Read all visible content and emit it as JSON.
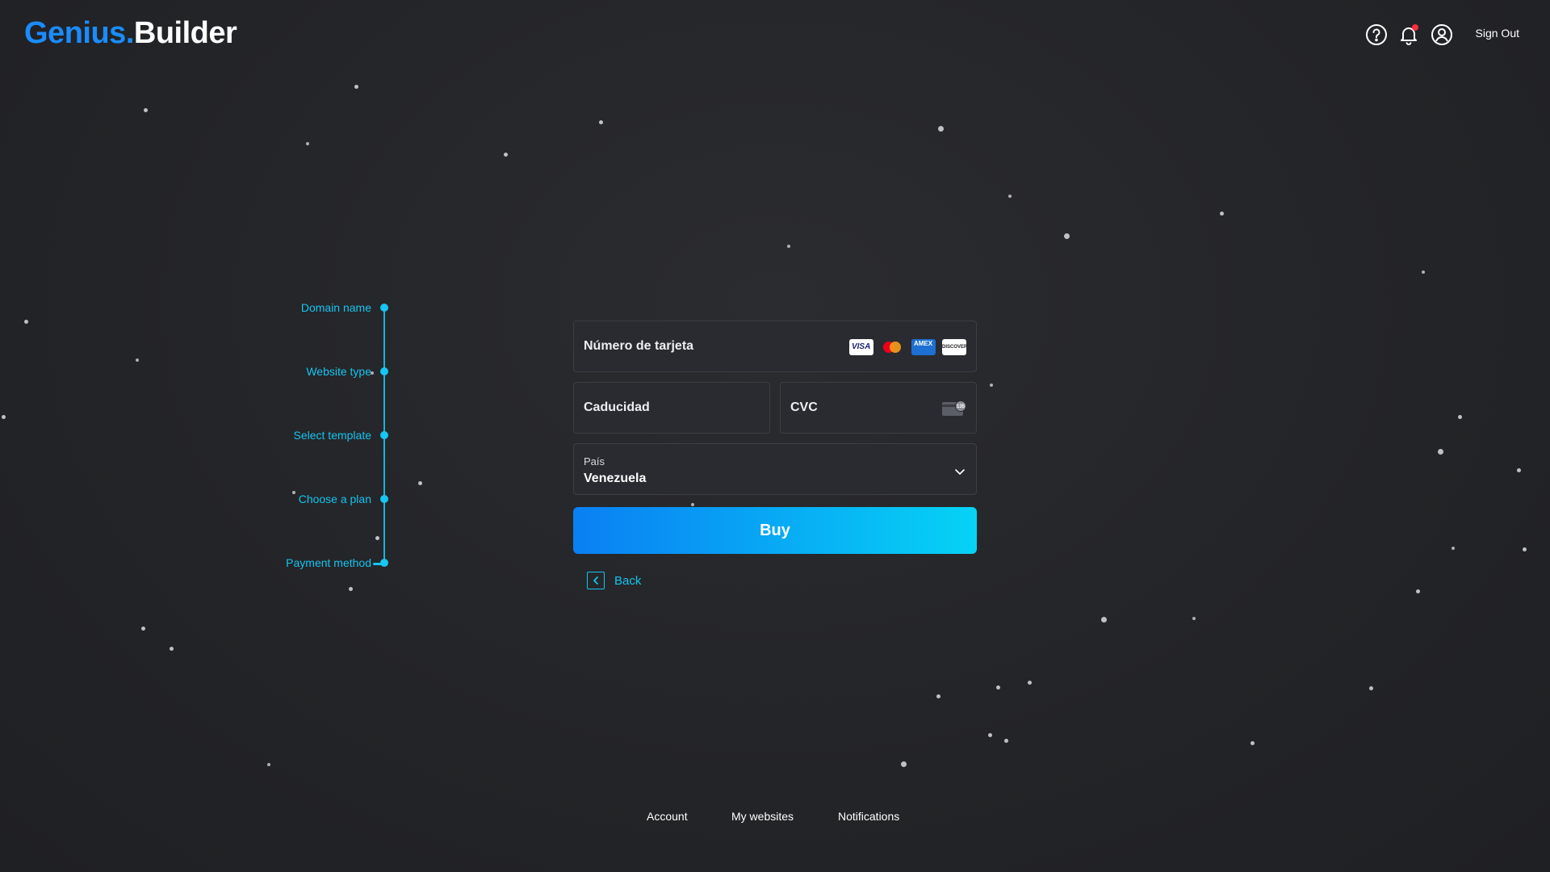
{
  "header": {
    "logo_part1": "Genius",
    "logo_dot": ".",
    "logo_part2": "Builder",
    "help_icon": "help-circle-icon",
    "notifications_icon": "bell-icon",
    "account_icon": "user-circle-icon",
    "sign_out": "Sign Out"
  },
  "stepper": {
    "steps": [
      {
        "label": "Domain name"
      },
      {
        "label": "Website type"
      },
      {
        "label": "Select template"
      },
      {
        "label": "Choose a plan"
      },
      {
        "label": "Payment method"
      }
    ],
    "active_step": "Payment method"
  },
  "payment_form": {
    "card_number_placeholder": "Número de tarjeta",
    "card_brands": [
      "VISA",
      "Mastercard",
      "AMEX",
      "DISCOVER"
    ],
    "expiry_placeholder": "Caducidad",
    "cvc_placeholder": "CVC",
    "cvc_icon_text": "135",
    "country_label": "País",
    "country_value": "Venezuela",
    "buy_label": "Buy",
    "back_label": "Back"
  },
  "footer": {
    "links": [
      {
        "label": "Account"
      },
      {
        "label": "My websites"
      },
      {
        "label": "Notifications"
      }
    ]
  },
  "colors": {
    "accent": "#16c4ef",
    "brand_blue": "#1a8cff",
    "button_gradient_start": "#0a7ff3",
    "button_gradient_end": "#06d3f5",
    "background": "#232427",
    "notification_dot": "#ff2d3d"
  }
}
